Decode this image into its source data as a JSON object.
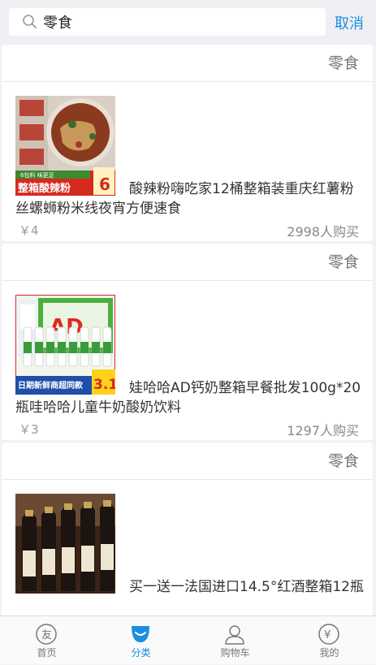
{
  "search": {
    "value": "零食",
    "cancel_label": "取消"
  },
  "products": [
    {
      "category": "零食",
      "title": "酸辣粉嗨吃家12桶整箱装重庆红薯粉丝螺蛳粉米线夜宵方便速食",
      "price": "￥4",
      "sold": "2998人购买",
      "image_banner": "整箱酸辣粉",
      "image_badge": "6",
      "image_sub": "6包料 味更足"
    },
    {
      "category": "零食",
      "title": "娃哈哈AD钙奶整箱早餐批发100g*20瓶哇哈哈儿童牛奶酸奶饮料",
      "price": "￥3",
      "sold": "1297人购买",
      "image_banner": "日期新鲜商超同款",
      "image_badge": "3.1",
      "image_sub": "AD钙奶"
    },
    {
      "category": "零食",
      "title": "买一送一法国进口14.5°红酒整箱12瓶",
      "price": "",
      "sold": ""
    }
  ],
  "tabbar": [
    {
      "label": "首页",
      "icon": "home-icon"
    },
    {
      "label": "分类",
      "icon": "category-icon",
      "active": true
    },
    {
      "label": "购物车",
      "icon": "cart-icon"
    },
    {
      "label": "我的",
      "icon": "profile-icon"
    }
  ],
  "colors": {
    "accent": "#1a8fe0",
    "background": "#f2f2f4"
  }
}
